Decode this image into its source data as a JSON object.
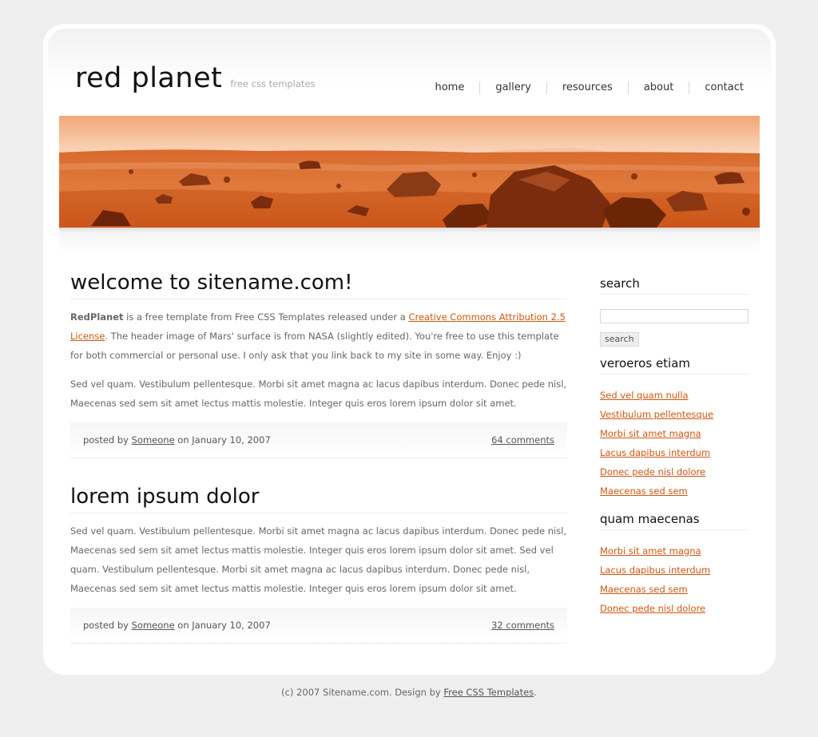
{
  "header": {
    "logo_title": "red planet",
    "logo_subtitle": "free css templates"
  },
  "nav": {
    "items": [
      "home",
      "gallery",
      "resources",
      "about",
      "contact"
    ]
  },
  "posts": [
    {
      "title": "welcome to sitename.com!",
      "p1_strong": "RedPlanet",
      "p1_text_a": " is a free template from Free CSS Templates released under a ",
      "p1_link": "Creative Commons Attribution 2.5 License",
      "p1_text_b": ". The header image of Mars' surface is from NASA (slightly edited). You're free to use this template for both commercial or personal use. I only ask that you link back to my site in some way. Enjoy :)",
      "p2": "Sed vel quam. Vestibulum pellentesque. Morbi sit amet magna ac lacus dapibus interdum. Donec pede nisl, Maecenas sed sem sit amet lectus mattis molestie. Integer quis eros lorem ipsum dolor sit amet.",
      "meta_posted_by": "posted by ",
      "meta_author": "Someone",
      "meta_on": " on January 10, 2007",
      "meta_comments": "64 comments"
    },
    {
      "title": "lorem ipsum dolor",
      "p1": "Sed vel quam. Vestibulum pellentesque. Morbi sit amet magna ac lacus dapibus interdum. Donec pede nisl, Maecenas sed sem sit amet lectus mattis molestie. Integer quis eros lorem ipsum dolor sit amet. Sed vel quam. Vestibulum pellentesque. Morbi sit amet magna ac lacus dapibus interdum. Donec pede nisl, Maecenas sed sem sit amet lectus mattis molestie. Integer quis eros lorem ipsum dolor sit amet.",
      "meta_posted_by": "posted by ",
      "meta_author": "Someone",
      "meta_on": " on January 10, 2007",
      "meta_comments": "32 comments"
    }
  ],
  "sidebar": {
    "search_title": "search",
    "search_button": "search",
    "search_value": "",
    "sections": [
      {
        "title": "veroeros etiam",
        "links": [
          "Sed vel quam nulla",
          "Vestibulum pellentesque",
          "Morbi sit amet magna",
          "Lacus dapibus interdum",
          "Donec pede nisl dolore",
          "Maecenas sed sem"
        ]
      },
      {
        "title": "quam maecenas",
        "links": [
          "Morbi sit amet magna",
          "Lacus dapibus interdum",
          "Maecenas sed sem",
          "Donec pede nisl dolore"
        ]
      }
    ]
  },
  "footer": {
    "text_a": "(c) 2007 Sitename.com. Design by ",
    "link": "Free CSS Templates",
    "text_b": "."
  },
  "colors": {
    "accent": "#d2550f",
    "background": "#efefef",
    "mars_light": "#f6c096",
    "mars_dark": "#c24a10"
  }
}
